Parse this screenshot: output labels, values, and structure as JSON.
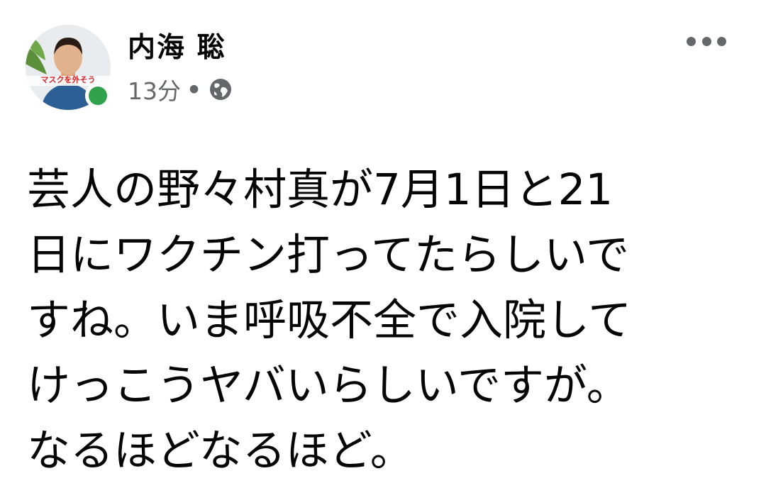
{
  "author": {
    "name": "内海 聡",
    "avatar_caption": "マスクを外そう",
    "online": true
  },
  "meta": {
    "time": "13分",
    "separator": "•",
    "privacy_icon": "globe-icon"
  },
  "more_icon": "more-options-icon",
  "post": {
    "lines": [
      "芸人の野々村真が7月1日と21",
      "日にワクチン打ってたらしいで",
      "すね。いま呼吸不全で入院して",
      "けっこうヤバいらしいですが。",
      "なるほどなるほど。"
    ]
  },
  "colors": {
    "online": "#31a24c",
    "secondary_text": "#65676b",
    "primary_text": "#050505"
  }
}
